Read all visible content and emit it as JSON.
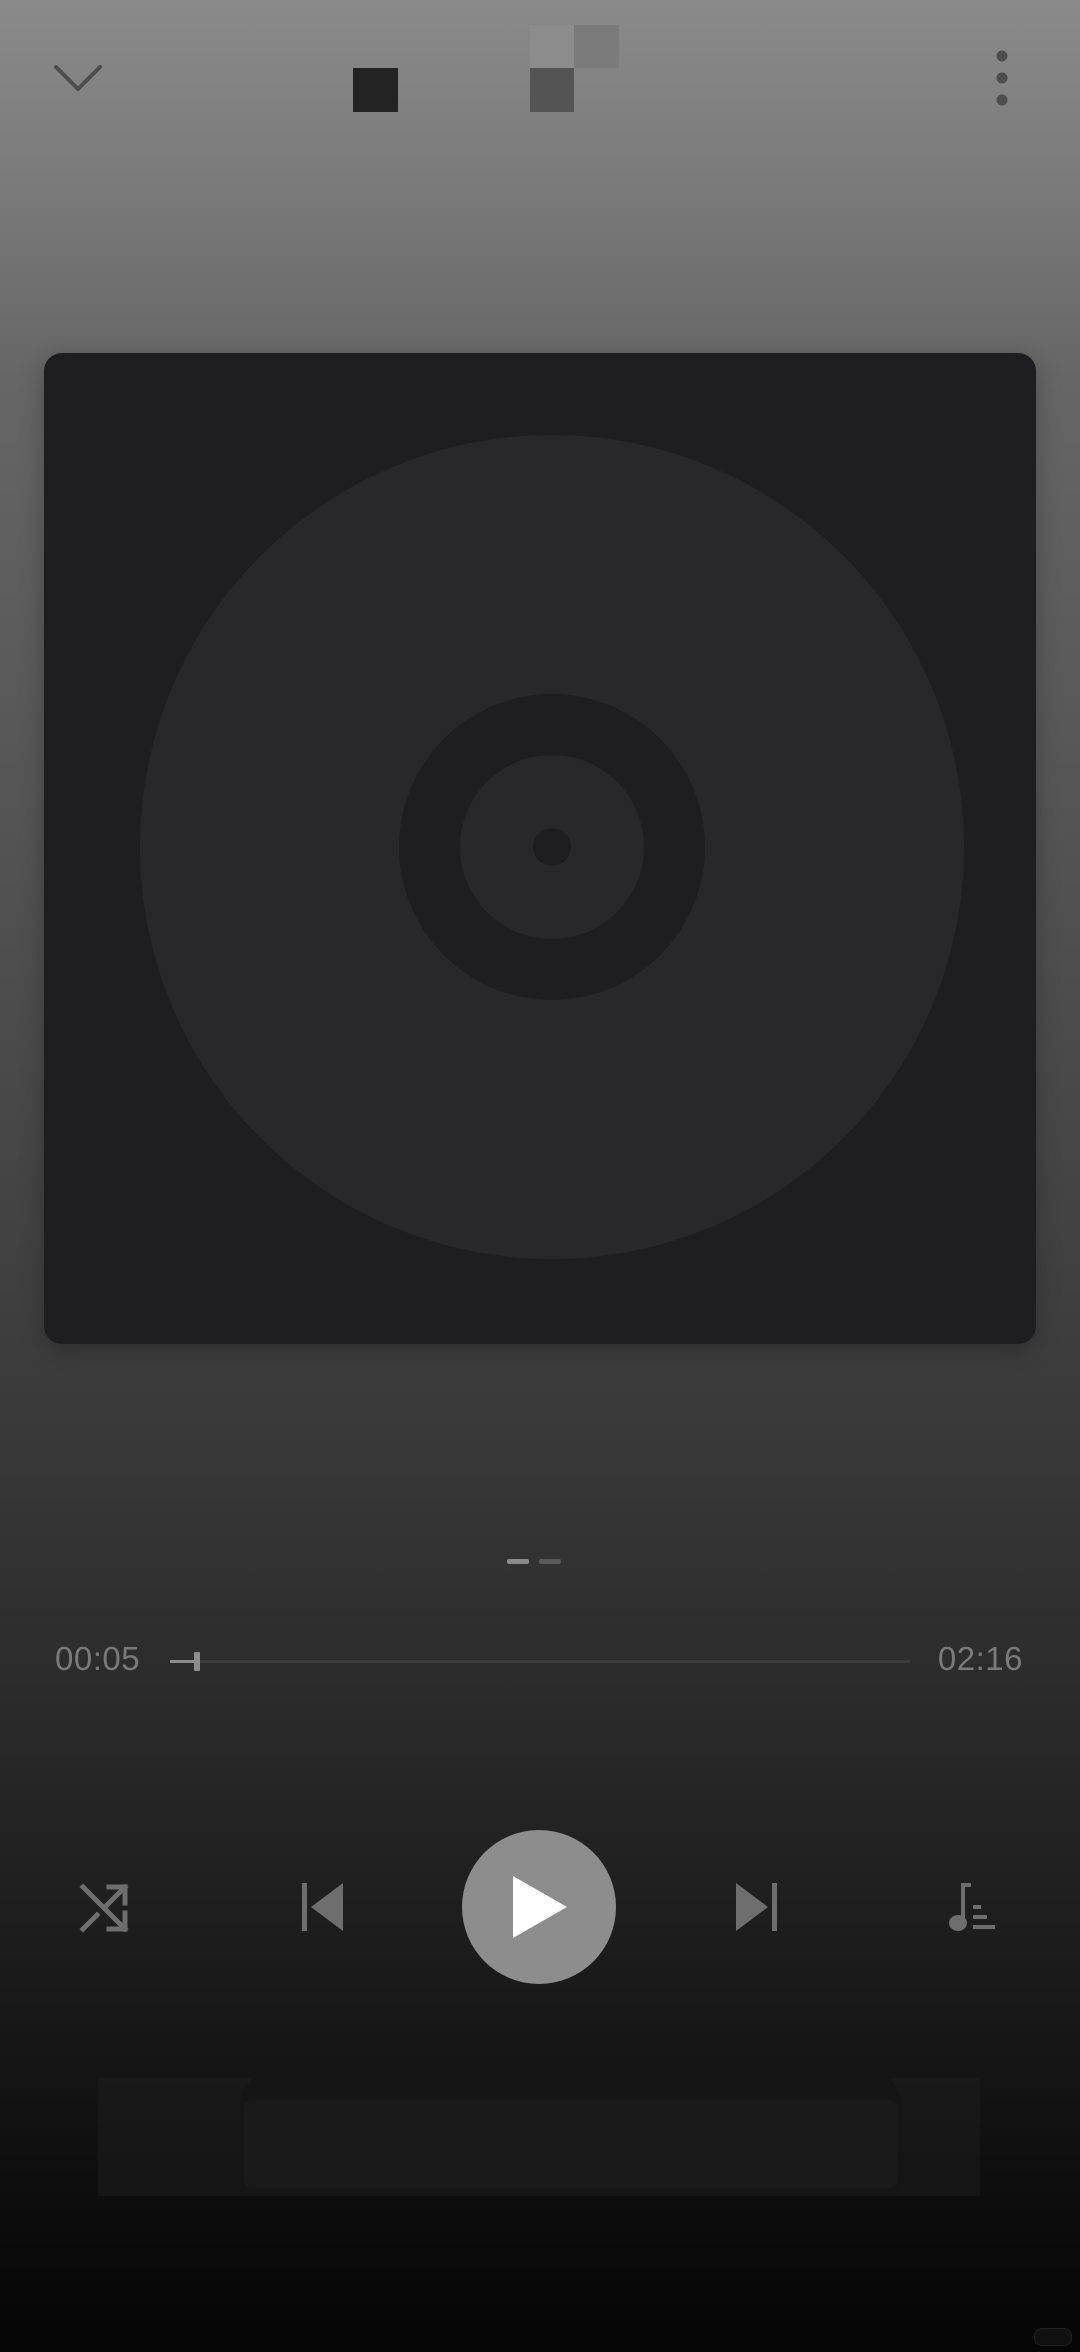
{
  "header": {
    "collapse_icon": "chevron-down-icon",
    "more_icon": "more-vertical-icon"
  },
  "album": {
    "placeholder_icon": "vinyl-disc-icon"
  },
  "pager": {
    "pages": 2,
    "active_index": 0
  },
  "progress": {
    "elapsed": "00:05",
    "total": "02:16",
    "fraction": 0.037
  },
  "controls": {
    "shuffle_icon": "shuffle-icon",
    "previous_icon": "skip-previous-icon",
    "play_icon": "play-icon",
    "next_icon": "skip-next-icon",
    "queue_icon": "playlist-queue-icon"
  },
  "colors": {
    "album_bg": "#1e1d20",
    "disc": "#28272a",
    "play_button": "#8d8d8d",
    "icon": "#6e6e6e",
    "time_text": "#7a7a7a"
  }
}
